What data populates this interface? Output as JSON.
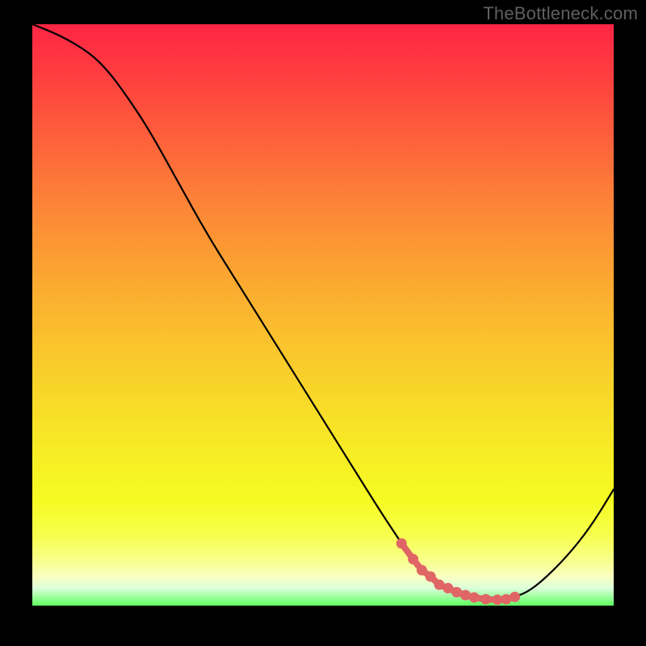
{
  "watermark": "TheBottleneck.com",
  "colors": {
    "black": "#000000",
    "dot": "#e06666",
    "gradient_top": "#fe2544",
    "gradient_bottom": "#5fff61"
  },
  "chart_data": {
    "type": "line",
    "title": "",
    "xlabel": "",
    "ylabel": "",
    "x": [
      0,
      5,
      10,
      13,
      16,
      20,
      25,
      30,
      35,
      40,
      45,
      50,
      55,
      60,
      63,
      65,
      68,
      70,
      72,
      74,
      76,
      78,
      80,
      82,
      85,
      88,
      92,
      96,
      100
    ],
    "y": [
      100,
      98,
      95,
      92,
      88,
      82,
      73,
      64,
      56,
      48,
      40,
      32,
      24,
      16,
      11.5,
      8.5,
      5.2,
      3.6,
      2.6,
      1.9,
      1.4,
      1.1,
      1.0,
      1.2,
      2.2,
      4.5,
      8.5,
      13.5,
      20
    ],
    "xlim": [
      0,
      100
    ],
    "ylim": [
      0,
      100
    ],
    "highlight_dots_x": [
      63.5,
      65.5,
      67,
      68.5,
      70,
      71.5,
      73,
      74.5,
      76,
      78,
      80,
      81.5,
      83
    ],
    "highlight_dots_y": [
      10.7,
      8.0,
      6.1,
      5.0,
      3.6,
      3.0,
      2.3,
      1.8,
      1.4,
      1.1,
      1.0,
      1.1,
      1.5
    ]
  }
}
